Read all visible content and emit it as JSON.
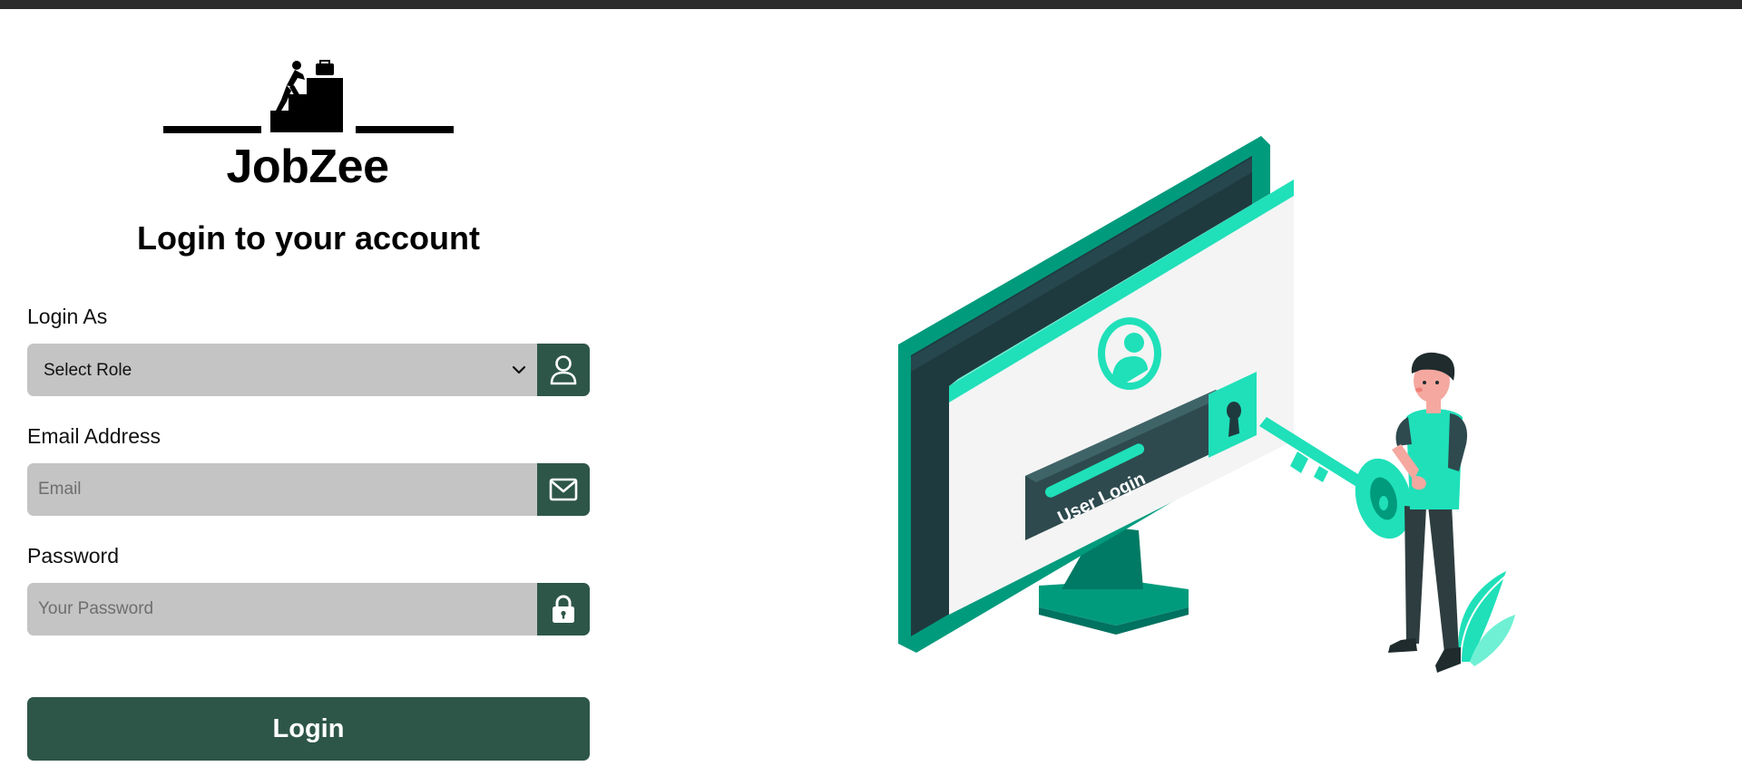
{
  "brand": {
    "name": "JobZee",
    "logo_icon": "climber-stairs-briefcase-icon"
  },
  "form": {
    "title": "Login to your account",
    "role": {
      "label": "Login As",
      "selected": "Select Role",
      "icon": "user-icon"
    },
    "email": {
      "label": "Email Address",
      "placeholder": "Email",
      "value": "",
      "icon": "envelope-icon"
    },
    "password": {
      "label": "Password",
      "placeholder": "Your Password",
      "value": "",
      "icon": "lock-icon"
    },
    "submit_label": "Login"
  },
  "illustration": {
    "screen_text": "User Login"
  },
  "colors": {
    "accent": "#2d5649",
    "field_bg": "#c4c4c4",
    "illustration_teal": "#00d9b3"
  }
}
